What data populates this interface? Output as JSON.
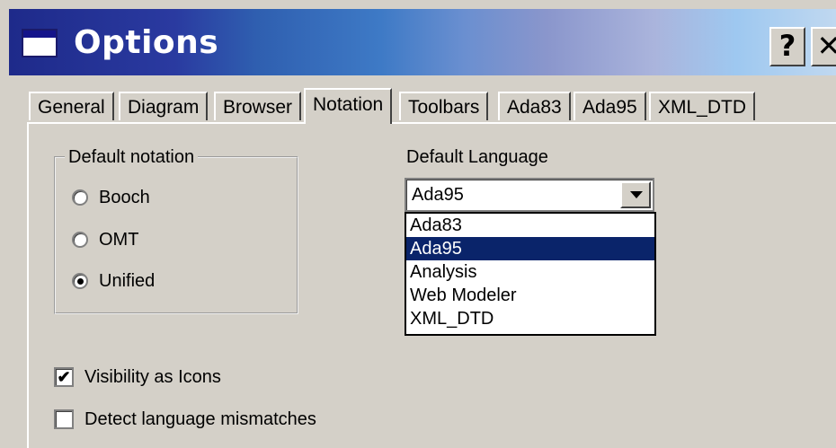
{
  "window": {
    "title": "Options",
    "help_label": "?",
    "close_label": "✕"
  },
  "tabs": [
    {
      "label": "General"
    },
    {
      "label": "Diagram"
    },
    {
      "label": "Browser"
    },
    {
      "label": "Notation",
      "active": true
    },
    {
      "label": "Toolbars"
    },
    {
      "label": "Ada83"
    },
    {
      "label": "Ada95"
    },
    {
      "label": "XML_DTD"
    }
  ],
  "notation_group": {
    "label": "Default notation",
    "options": [
      {
        "label": "Booch",
        "checked": false
      },
      {
        "label": "OMT",
        "checked": false
      },
      {
        "label": "Unified",
        "checked": true
      }
    ]
  },
  "language": {
    "label": "Default Language",
    "value": "Ada95",
    "options": [
      "Ada83",
      "Ada95",
      "Analysis",
      "Web Modeler",
      "XML_DTD"
    ],
    "highlighted": "Ada95"
  },
  "checkboxes": [
    {
      "label": "Visibility as Icons",
      "checked": true,
      "mark": "✔"
    },
    {
      "label": "Detect language mismatches",
      "checked": false,
      "mark": ""
    }
  ],
  "colors": {
    "selection": "#0a246a",
    "dialog_bg": "#d4d0c8"
  }
}
